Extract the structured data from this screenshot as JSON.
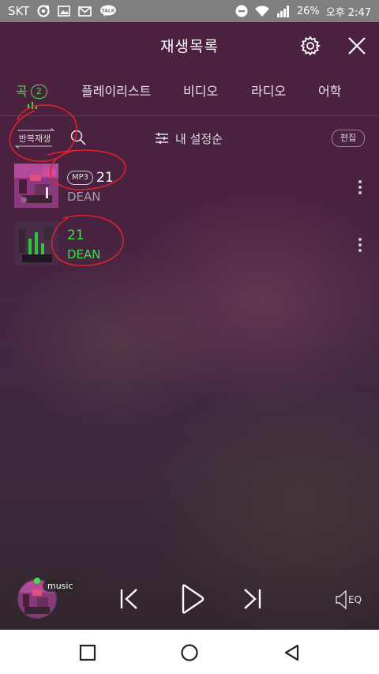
{
  "status_bar": {
    "carrier": "SKT",
    "battery": "26%",
    "time": "오후 2:47",
    "icons": [
      "target-icon",
      "image-icon",
      "mail-icon",
      "talk-icon",
      "dnd-icon",
      "wifi-icon",
      "signal-icon"
    ]
  },
  "header": {
    "title": "재생목록",
    "settings_icon": "gear-icon",
    "close_icon": "close-icon"
  },
  "tabs": {
    "items": [
      {
        "label": "곡",
        "badge": "2",
        "active": true
      },
      {
        "label": "플레이리스트"
      },
      {
        "label": "비디오"
      },
      {
        "label": "라디오"
      },
      {
        "label": "어학"
      }
    ]
  },
  "toolbar": {
    "repeat_label": "반복재생",
    "sort_label": "내 설정순",
    "edit_label": "편집"
  },
  "tracks": [
    {
      "badge": "MP3",
      "title": "21",
      "artist": "DEAN",
      "playing": false
    },
    {
      "title": "21",
      "artist": "DEAN",
      "playing": true
    }
  ],
  "player": {
    "source_label": "music",
    "eq_label": "EQ"
  },
  "colors": {
    "accent": "#3ee04a",
    "annotation": "#e0202c"
  }
}
